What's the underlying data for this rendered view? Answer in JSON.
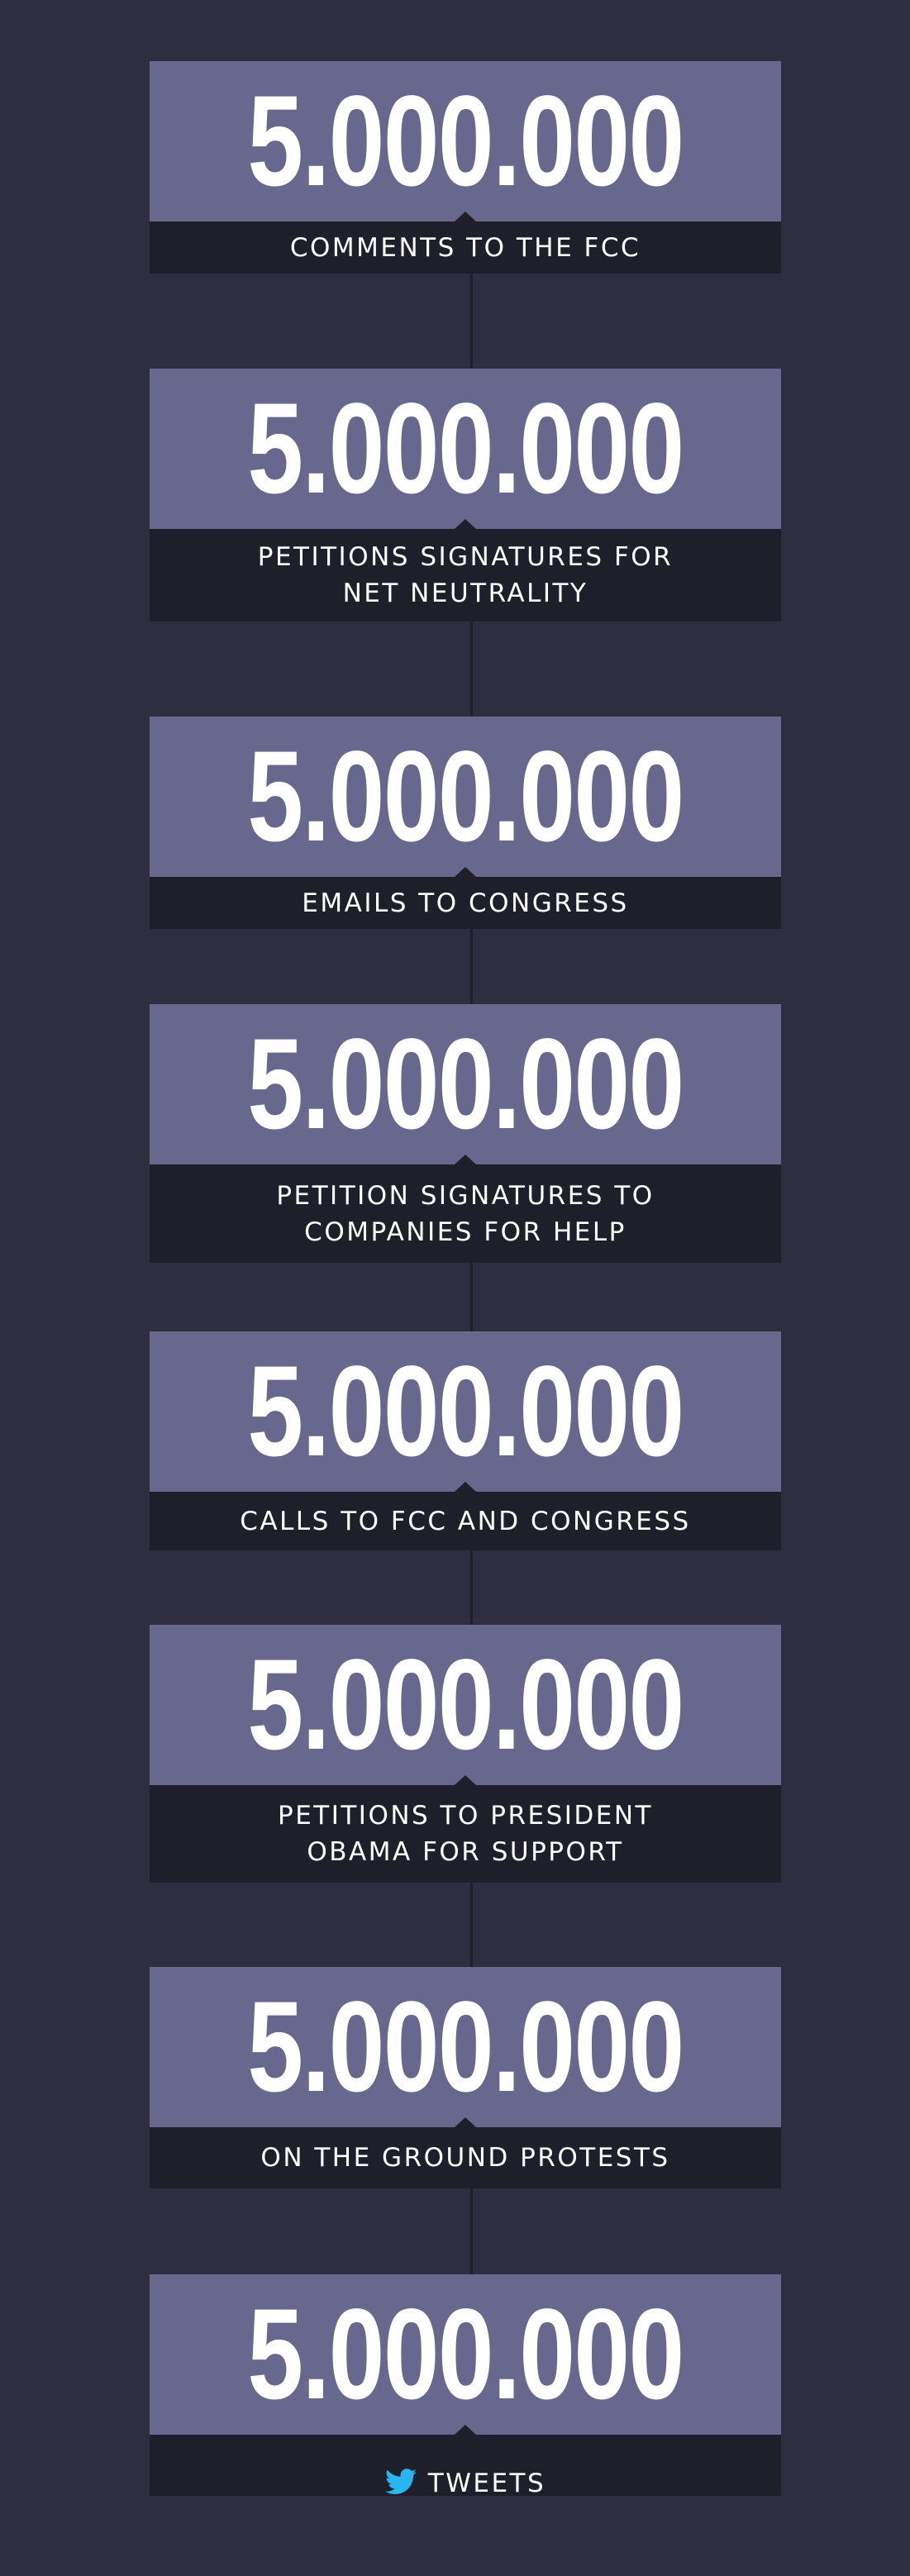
{
  "accent": "#68678d",
  "background": "#2f2e41",
  "label_background": "#1f1f2b",
  "twitter_color": "#29b6f0",
  "stats": [
    {
      "number": "5.000.000",
      "label": "COMMENTS TO THE FCC"
    },
    {
      "number": "5.000.000",
      "label": "PETITIONS SIGNATURES FOR\nNET NEUTRALITY"
    },
    {
      "number": "5.000.000",
      "label": "EMAILS TO CONGRESS"
    },
    {
      "number": "5.000.000",
      "label": "PETITION SIGNATURES TO\nCOMPANIES FOR HELP"
    },
    {
      "number": "5.000.000",
      "label": "CALLS TO FCC AND CONGRESS"
    },
    {
      "number": "5.000.000",
      "label": "PETITIONS TO PRESIDENT\nOBAMA FOR SUPPORT"
    },
    {
      "number": "5.000.000",
      "label": "ON THE GROUND PROTESTS"
    },
    {
      "number": "5.000.000",
      "label": "TWEETS",
      "icon": "twitter-bird-icon"
    }
  ]
}
